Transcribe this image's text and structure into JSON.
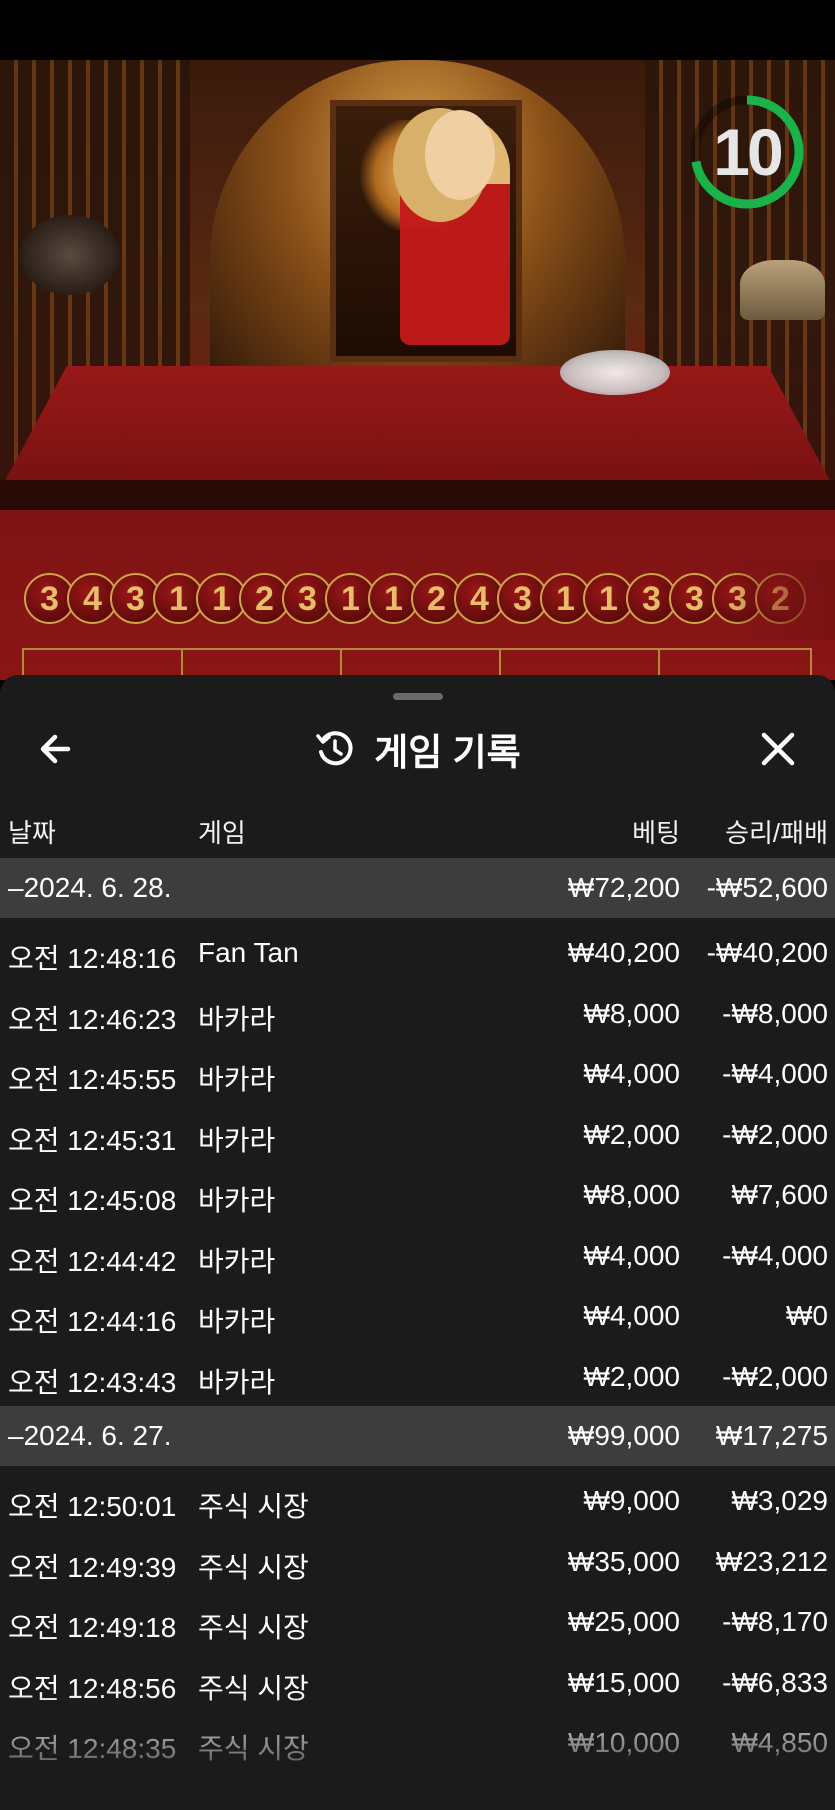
{
  "timer": {
    "value": "10",
    "progress": 0.72,
    "color": "#19b34a"
  },
  "results_road": [
    "3",
    "4",
    "3",
    "1",
    "1",
    "2",
    "3",
    "1",
    "1",
    "2",
    "4",
    "3",
    "1",
    "1",
    "3",
    "3",
    "3",
    "2"
  ],
  "sheet": {
    "title": "게임 기록",
    "back_icon": "arrow-left-icon",
    "history_icon": "history-clock-icon",
    "close_icon": "close-x-icon"
  },
  "columns": {
    "date": "날짜",
    "game": "게임",
    "bet": "베팅",
    "winloss": "승리/패배"
  },
  "groups": [
    {
      "date": "–2024. 6. 28.",
      "bet": "₩72,200",
      "winloss": "-₩52,600",
      "rows": [
        {
          "time": "오전 12:48:16",
          "game": "Fan Tan",
          "bet": "₩40,200",
          "winloss": "-₩40,200"
        },
        {
          "time": "오전 12:46:23",
          "game": "바카라",
          "bet": "₩8,000",
          "winloss": "-₩8,000"
        },
        {
          "time": "오전 12:45:55",
          "game": "바카라",
          "bet": "₩4,000",
          "winloss": "-₩4,000"
        },
        {
          "time": "오전 12:45:31",
          "game": "바카라",
          "bet": "₩2,000",
          "winloss": "-₩2,000"
        },
        {
          "time": "오전 12:45:08",
          "game": "바카라",
          "bet": "₩8,000",
          "winloss": "₩7,600"
        },
        {
          "time": "오전 12:44:42",
          "game": "바카라",
          "bet": "₩4,000",
          "winloss": "-₩4,000"
        },
        {
          "time": "오전 12:44:16",
          "game": "바카라",
          "bet": "₩4,000",
          "winloss": "₩0"
        },
        {
          "time": "오전 12:43:43",
          "game": "바카라",
          "bet": "₩2,000",
          "winloss": "-₩2,000"
        }
      ]
    },
    {
      "date": "–2024. 6. 27.",
      "bet": "₩99,000",
      "winloss": "₩17,275",
      "rows": [
        {
          "time": "오전 12:50:01",
          "game": "주식 시장",
          "bet": "₩9,000",
          "winloss": "₩3,029"
        },
        {
          "time": "오전 12:49:39",
          "game": "주식 시장",
          "bet": "₩35,000",
          "winloss": "₩23,212"
        },
        {
          "time": "오전 12:49:18",
          "game": "주식 시장",
          "bet": "₩25,000",
          "winloss": "-₩8,170"
        },
        {
          "time": "오전 12:48:56",
          "game": "주식 시장",
          "bet": "₩15,000",
          "winloss": "-₩6,833"
        },
        {
          "time": "오전 12:48:35",
          "game": "주식 시장",
          "bet": "₩10,000",
          "winloss": "₩4,850"
        }
      ]
    }
  ]
}
